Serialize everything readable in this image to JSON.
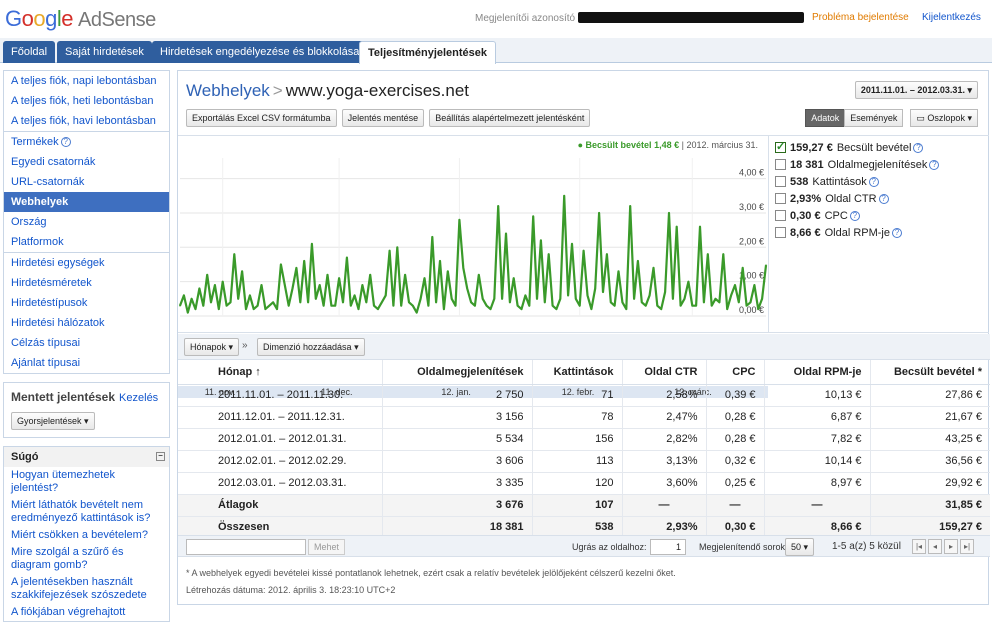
{
  "header": {
    "logo_google": "Google",
    "logo_adsense": "AdSense",
    "publisher_id_label": "Megjelenítői azonosító",
    "report_problem": "Probléma bejelentése",
    "logout": "Kijelentkezés"
  },
  "nav": {
    "tabs": [
      {
        "label": "Főoldal"
      },
      {
        "label": "Saját hirdetések"
      },
      {
        "label": "Hirdetések engedélyezése és blokkolása"
      },
      {
        "label": "Teljesítményjelentések",
        "active": true
      }
    ]
  },
  "sidebar": {
    "group1": [
      "A teljes fiók, napi lebontásban",
      "A teljes fiók, heti lebontásban",
      "A teljes fiók, havi lebontásban"
    ],
    "group2": [
      "Termékek",
      "Egyedi csatornák",
      "URL-csatornák",
      "Webhelyek",
      "Ország",
      "Platformok"
    ],
    "group3": [
      "Hirdetési egységek",
      "Hirdetésméretek",
      "Hirdetéstípusok",
      "Hirdetési hálózatok",
      "Célzás típusai",
      "Ajánlat típusai"
    ],
    "selected": "Webhelyek",
    "saved_title": "Mentett jelentések",
    "saved_manage": "Kezelés",
    "quick_reports": "Gyorsjelentések",
    "help_title": "Súgó",
    "help_links": [
      "Hogyan ütemezhetek jelentést?",
      "Miért láthatók bevételt nem eredményező kattintások is?",
      "Miért csökken a bevételem?",
      "Mire szolgál a szűrő és diagram gomb?",
      "A jelentésekben használt szakkifejezések szószedete",
      "A fiókjában végrehajtott"
    ]
  },
  "main": {
    "breadcrumb": "Webhelyek",
    "site": "www.yoga-exercises.net",
    "date_range": "2011.11.01. – 2012.03.31.",
    "buttons": {
      "export": "Exportálás Excel CSV formátumba",
      "save": "Jelentés mentése",
      "set_default": "Beállítás alapértelmezett jelentésként",
      "data": "Adatok",
      "events": "Események",
      "columns": "Oszlopok"
    },
    "chart_legend": {
      "label": "Becsült bevétel",
      "value": "1,48 €",
      "date": "2012. március 31."
    },
    "metrics": [
      {
        "value": "159,27 €",
        "label": "Becsült bevétel",
        "checked": true
      },
      {
        "value": "18 381",
        "label": "Oldalmegjelenítések",
        "checked": false
      },
      {
        "value": "538",
        "label": "Kattintások",
        "checked": false
      },
      {
        "value": "2,93%",
        "label": "Oldal CTR",
        "checked": false
      },
      {
        "value": "0,30 €",
        "label": "CPC",
        "checked": false
      },
      {
        "value": "8,66 €",
        "label": "Oldal RPM-je",
        "checked": false
      }
    ],
    "dimension_dd": "Hónapok",
    "add_dimension": "Dimenzió hozzáadása",
    "table": {
      "headers": [
        "Hónap",
        "Oldalmegjelenítések",
        "Kattintások",
        "Oldal CTR",
        "CPC",
        "Oldal RPM-je",
        "Becsült bevétel *"
      ],
      "rows": [
        [
          "2011.11.01. – 2011.11.30.",
          "2 750",
          "71",
          "2,58%",
          "0,39 €",
          "10,13 €",
          "27,86 €"
        ],
        [
          "2011.12.01. – 2011.12.31.",
          "3 156",
          "78",
          "2,47%",
          "0,28 €",
          "6,87 €",
          "21,67 €"
        ],
        [
          "2012.01.01. – 2012.01.31.",
          "5 534",
          "156",
          "2,82%",
          "0,28 €",
          "7,82 €",
          "43,25 €"
        ],
        [
          "2012.02.01. – 2012.02.29.",
          "3 606",
          "113",
          "3,13%",
          "0,32 €",
          "10,14 €",
          "36,56 €"
        ],
        [
          "2012.03.01. – 2012.03.31.",
          "3 335",
          "120",
          "3,60%",
          "0,25 €",
          "8,97 €",
          "29,92 €"
        ]
      ],
      "average": [
        "Átlagok",
        "3 676",
        "107",
        "—",
        "—",
        "—",
        "31,85 €"
      ],
      "total": [
        "Összesen",
        "18 381",
        "538",
        "2,93%",
        "0,30 €",
        "8,66 €",
        "159,27 €"
      ]
    },
    "pager": {
      "filter_btn": "Mehet",
      "goto_label": "Ugrás az oldalhoz:",
      "page_value": "1",
      "rows_label": "Megjelenítendő sorok:",
      "rows_value": "50",
      "count_text": "1-5 a(z) 5 közül"
    },
    "footnote": "* A webhelyek egyedi bevételei kissé pontatlanok lehetnek, ezért csak a relatív bevételek jelölőjeként célszerű kezelni őket.",
    "created": "Létrehozás dátuma: 2012. április 3. 18:23:10 UTC+2"
  },
  "chart_data": {
    "type": "line",
    "series_color": "#3a9a2a",
    "ylim": [
      0,
      4.6
    ],
    "y_ticks": [
      "4,00 €",
      "3,00 €",
      "2,00 €",
      "1,00 €",
      "0,00 €"
    ],
    "y_tick_values": [
      4,
      3,
      2,
      1,
      0
    ],
    "x_ticks": [
      "11. nov.",
      "11. dec.",
      "12. jan.",
      "12. febr.",
      "12. márc."
    ],
    "x_tick_index": [
      11,
      41,
      72,
      103,
      132
    ],
    "values": [
      0.3,
      0.6,
      0.1,
      0.5,
      0.2,
      0.8,
      0.3,
      1.2,
      0.4,
      0.9,
      0.2,
      1.0,
      0.3,
      0.4,
      1.8,
      0.5,
      1.3,
      0.2,
      0.6,
      0.2,
      0.3,
      0.9,
      0.2,
      0.3,
      0.4,
      0.2,
      1.5,
      0.9,
      0.3,
      0.8,
      1.4,
      0.4,
      1.6,
      0.4,
      2.1,
      0.5,
      0.9,
      0.3,
      1.2,
      0.3,
      0.3,
      1.1,
      0.4,
      1.7,
      0.3,
      0.6,
      0.2,
      0.9,
      0.4,
      1.2,
      0.3,
      0.2,
      0.4,
      0.6,
      1.9,
      0.3,
      2.0,
      0.3,
      1.2,
      0.4,
      0.3,
      0.1,
      0.5,
      1.1,
      0.3,
      2.3,
      0.4,
      1.6,
      0.2,
      1.3,
      0.5,
      0.3,
      2.8,
      1.4,
      0.8,
      0.4,
      0.3,
      1.2,
      0.5,
      0.3,
      0.2,
      0.5,
      3.2,
      0.5,
      2.4,
      0.4,
      1.1,
      0.3,
      0.2,
      0.6,
      0.3,
      2.9,
      0.5,
      2.2,
      0.4,
      1.8,
      0.3,
      0.2,
      0.5,
      3.5,
      0.6,
      2.1,
      0.5,
      0.3,
      1.9,
      0.6,
      0.2,
      0.8,
      3.0,
      0.7,
      1.8,
      0.4,
      0.3,
      1.3,
      0.4,
      0.2,
      3.2,
      0.5,
      1.6,
      0.4,
      0.3,
      0.6,
      1.4,
      0.3,
      0.2,
      0.7,
      3.0,
      0.5,
      2.6,
      0.3,
      0.5,
      1.0,
      0.3,
      0.3,
      2.6,
      0.4,
      1.8,
      0.3,
      0.5,
      0.4,
      1.8,
      0.2,
      0.6,
      0.9,
      0.4,
      1.4,
      0.3,
      0.4,
      0.9,
      0.2,
      0.5,
      1.48
    ]
  }
}
